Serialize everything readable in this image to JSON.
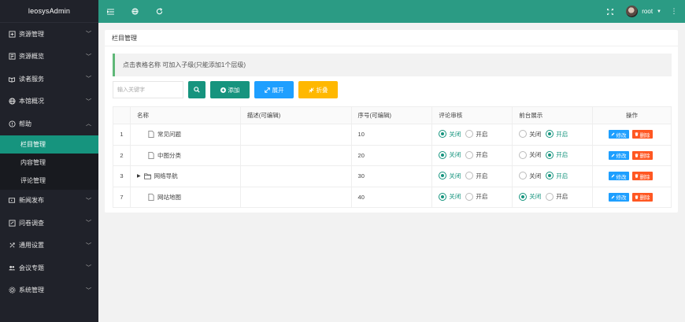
{
  "app": {
    "title": "leosysAdmin"
  },
  "sidebar": {
    "items": [
      {
        "label": "资源管理",
        "icon": "resource-icon"
      },
      {
        "label": "资源概览",
        "icon": "overview-icon"
      },
      {
        "label": "读者服务",
        "icon": "reader-icon"
      },
      {
        "label": "本馆概况",
        "icon": "globe-icon"
      },
      {
        "label": "帮助",
        "icon": "help-icon"
      }
    ],
    "submenu": [
      {
        "label": "栏目管理",
        "active": true
      },
      {
        "label": "内容管理",
        "active": false
      },
      {
        "label": "评论管理",
        "active": false
      }
    ],
    "items_after": [
      {
        "label": "新闻发布",
        "icon": "news-icon"
      },
      {
        "label": "问卷调查",
        "icon": "survey-icon"
      },
      {
        "label": "通用设置",
        "icon": "settings-icon"
      },
      {
        "label": "会议专题",
        "icon": "meeting-icon"
      },
      {
        "label": "系统管理",
        "icon": "gear-icon"
      }
    ]
  },
  "header": {
    "username": "root"
  },
  "page": {
    "title": "栏目管理",
    "tip": "点击表格名称 可加入子级(只能添加1个层级)"
  },
  "toolbar": {
    "search_placeholder": "输入关键字",
    "add_label": "添加",
    "expand_label": "展开",
    "collapse_label": "折叠"
  },
  "table": {
    "headers": {
      "name": "名称",
      "desc": "描述(可编辑)",
      "order": "序号(可编辑)",
      "review": "评论审核",
      "display": "前台展示",
      "ops": "操作"
    },
    "radio_off": "关闭",
    "radio_on": "开启",
    "edit_label": "修改",
    "delete_label": "删除",
    "rows": [
      {
        "id": "1",
        "name": "常见问题",
        "desc": "",
        "order": "10",
        "review": "关闭",
        "display": "开启",
        "expandable": false
      },
      {
        "id": "2",
        "name": "中图分类",
        "desc": "",
        "order": "20",
        "review": "关闭",
        "display": "开启",
        "expandable": false
      },
      {
        "id": "3",
        "name": "网络导航",
        "desc": "",
        "order": "30",
        "review": "关闭",
        "display": "开启",
        "expandable": true
      },
      {
        "id": "7",
        "name": "网站地图",
        "desc": "",
        "order": "40",
        "review": "关闭",
        "display": "关闭",
        "expandable": false
      }
    ]
  },
  "colors": {
    "primary": "#16947e",
    "header": "#2b9b84",
    "blue": "#1e9fff",
    "orange": "#ffb800",
    "red": "#ff5722"
  }
}
